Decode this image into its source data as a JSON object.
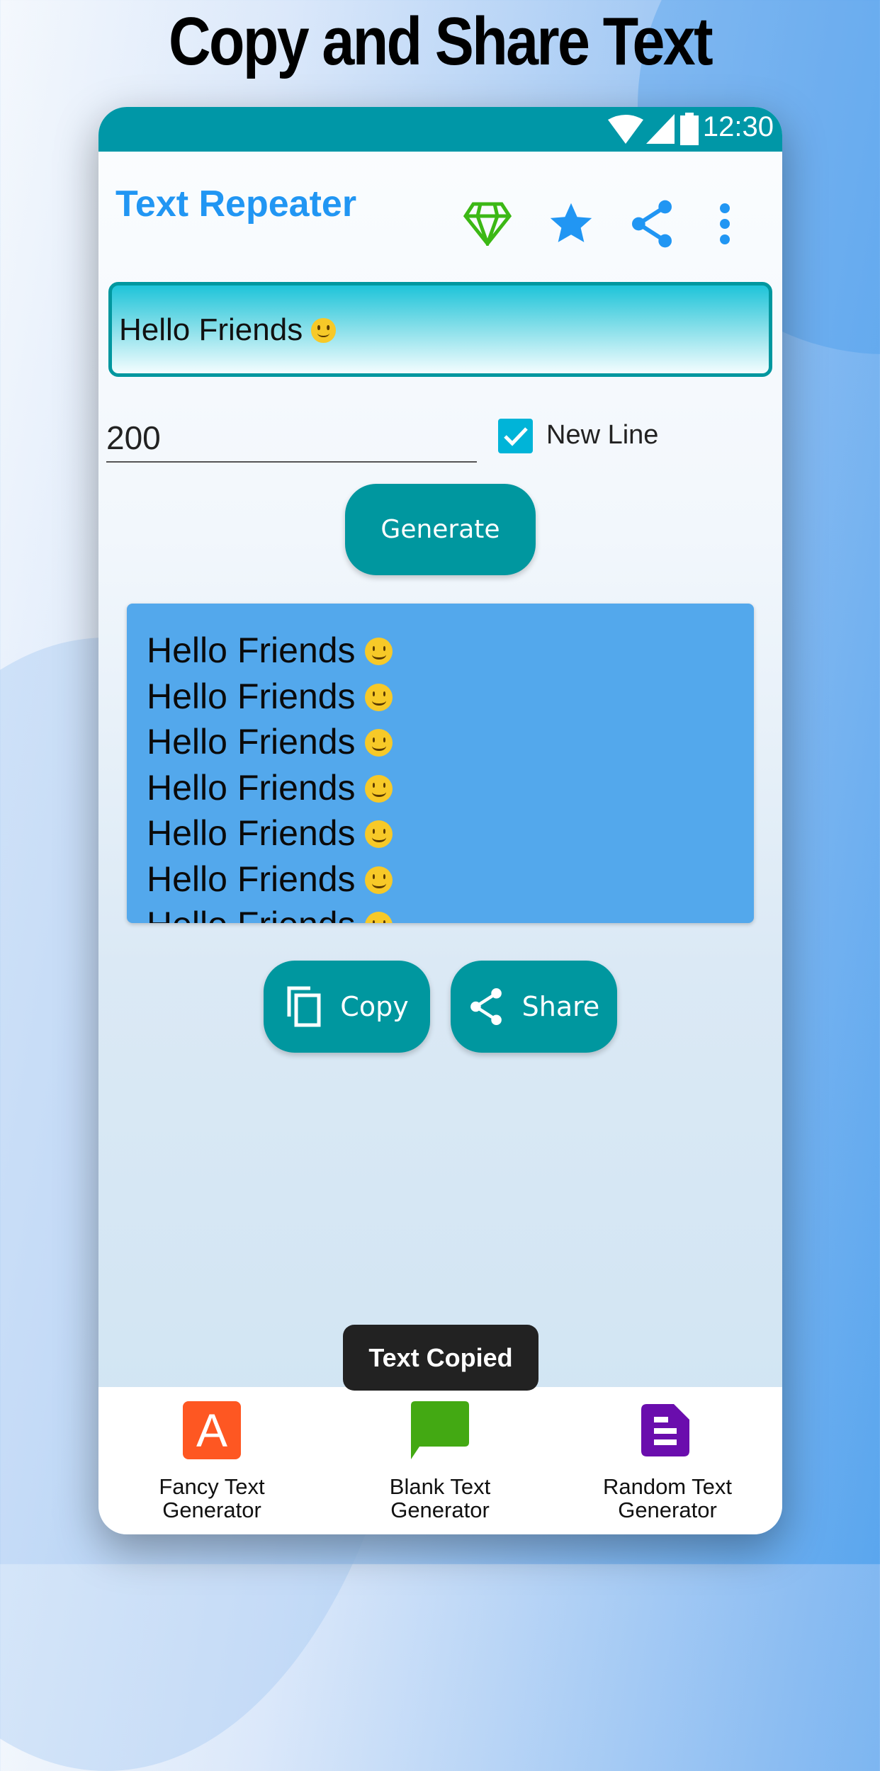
{
  "headline": "Copy and Share Text",
  "status_bar": {
    "time": "12:30"
  },
  "toolbar": {
    "title": "Text Repeater",
    "icons": [
      "diamond-icon",
      "star-icon",
      "share-icon",
      "more-vert-icon"
    ]
  },
  "input": {
    "text": "Hello Friends",
    "emoji": "slightly-smiling-face"
  },
  "repeat_count": "200",
  "new_line": {
    "label": "New Line",
    "checked": true
  },
  "generate_label": "Generate",
  "output": {
    "lines": [
      "Hello Friends",
      "Hello Friends",
      "Hello Friends",
      "Hello Friends",
      "Hello Friends",
      "Hello Friends",
      "Hello Friends"
    ]
  },
  "actions": {
    "copy": "Copy",
    "share": "Share"
  },
  "toast": "Text Copied",
  "bottom_nav": [
    {
      "line1": "Fancy Text",
      "line2": "Generator",
      "color": "#fe5722"
    },
    {
      "line1": "Blank Text",
      "line2": "Generator",
      "color": "#43a913"
    },
    {
      "line1": "Random Text",
      "line2": "Generator",
      "color": "#6a0dad"
    }
  ],
  "colors": {
    "primary": "#0097a7",
    "title": "#2196f3",
    "output_bg": "#53a8ec"
  }
}
